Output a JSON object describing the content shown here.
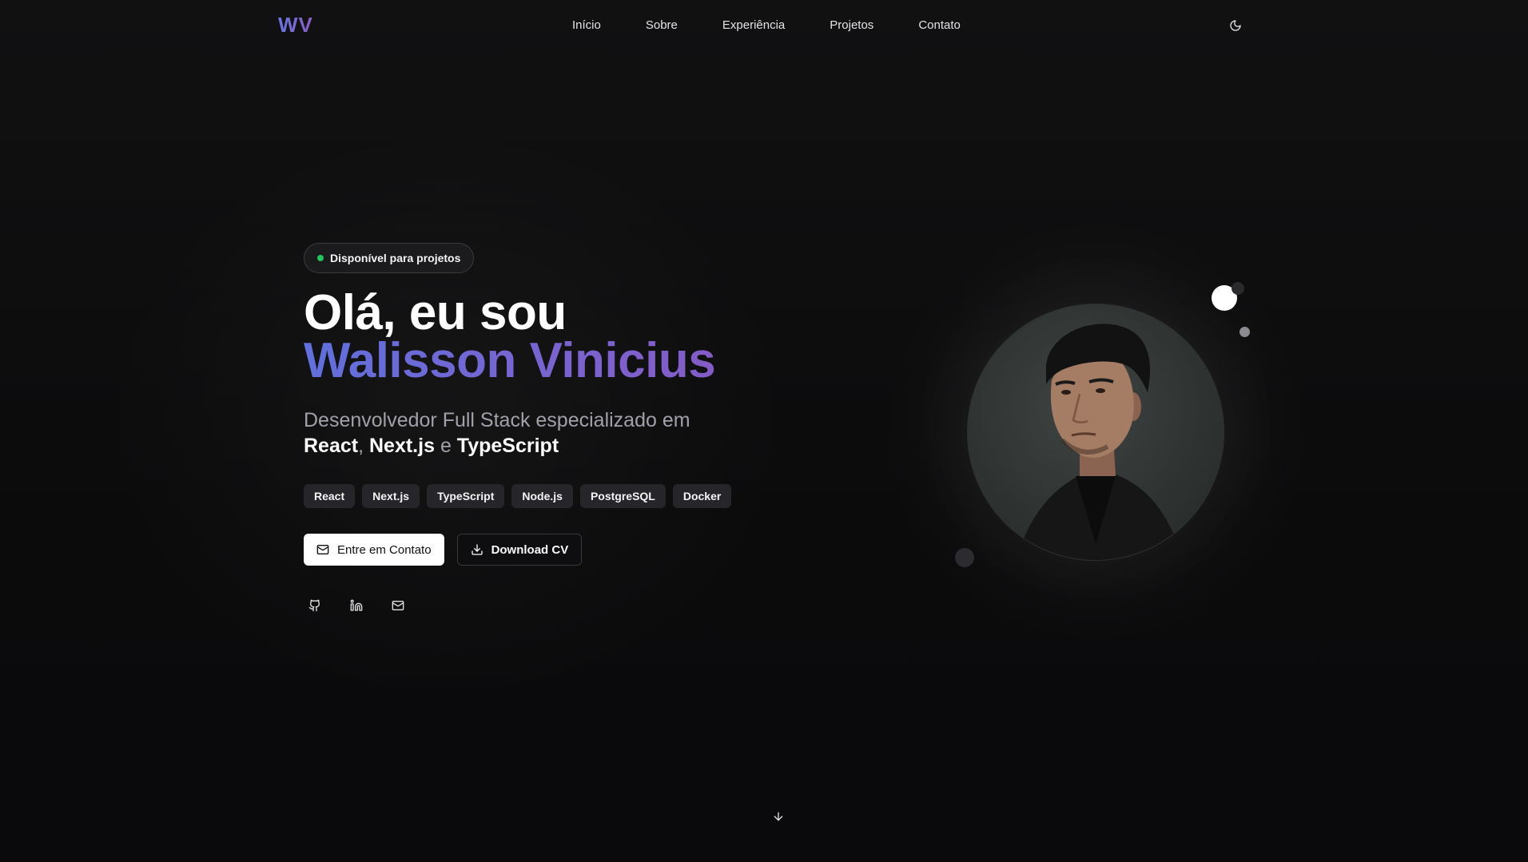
{
  "header": {
    "logo": "WV",
    "nav": [
      "Início",
      "Sobre",
      "Experiência",
      "Projetos",
      "Contato"
    ],
    "theme_toggle_icon": "moon-icon"
  },
  "hero": {
    "badge": "Disponível para projetos",
    "greeting": "Olá, eu sou",
    "name": "Walisson Vinicius",
    "subtitle_prefix": "Desenvolvedor Full Stack especializado em",
    "subtitle_tech1": "React",
    "subtitle_sep1": ",",
    "subtitle_tech2": "Next.js",
    "subtitle_sep2": "e",
    "subtitle_tech3": "TypeScript",
    "tags": [
      "React",
      "Next.js",
      "TypeScript",
      "Node.js",
      "PostgreSQL",
      "Docker"
    ],
    "contact_button": "Entre em Contato",
    "cv_button": "Download CV",
    "socials": [
      "github-icon",
      "linkedin-icon",
      "mail-icon"
    ]
  },
  "colors": {
    "accent_start": "#6070dc",
    "accent_end": "#8c56be",
    "status_dot": "#22c55e"
  }
}
